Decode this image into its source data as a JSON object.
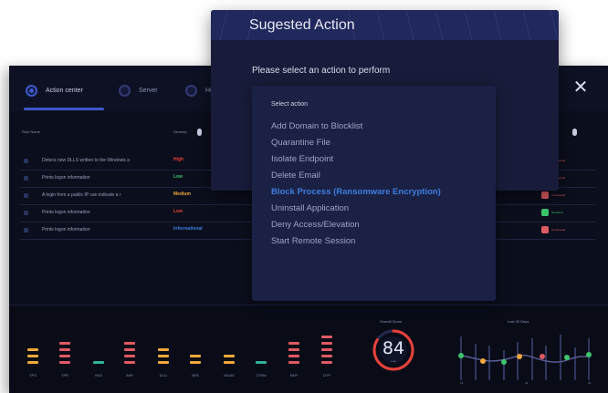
{
  "dashboard": {
    "tabs": [
      {
        "label": "Action center",
        "icon": "radio-icon",
        "active": true
      },
      {
        "label": "Server",
        "icon": "radio-icon",
        "active": false
      },
      {
        "label": "Hist",
        "icon": "radio-icon",
        "active": false
      }
    ],
    "close_glyph": "✕",
    "table": {
      "headers": {
        "name": "Rule Name",
        "severity": "Severity"
      },
      "rows": [
        {
          "name": "Detecs new DLLS written to the Windows a",
          "severity": "High",
          "severity_color": "#e8413a",
          "state": "Unresolved",
          "state_color": "#e05a63"
        },
        {
          "name": "Prints logon information",
          "severity": "Low",
          "severity_color": "#3cc46c",
          "state": "Unresolved",
          "state_color": "#e05a63"
        },
        {
          "name": "A login from a public IP can indicate a r",
          "severity": "Medium",
          "severity_color": "#f2a93b",
          "state": "Unresolved",
          "state_color": "#e05a63"
        },
        {
          "name": "Prints logon information",
          "severity": "Low",
          "severity_color": "#e8413a",
          "state": "Resolved",
          "state_color": "#3cc46c"
        },
        {
          "name": "Prints logon information",
          "severity": "Informational",
          "severity_color": "#3e7de0",
          "state": "Unresolved",
          "state_color": "#e05a63"
        }
      ]
    },
    "meters": [
      {
        "label": "TPS",
        "segments": 3,
        "color": "#f2a93b"
      },
      {
        "label": "TPR",
        "segments": 4,
        "color": "#e05a63"
      },
      {
        "label": "VND",
        "segments": 1,
        "color": "#2fb39a"
      },
      {
        "label": "SHP",
        "segments": 4,
        "color": "#e05a63"
      },
      {
        "label": "DCU",
        "segments": 3,
        "color": "#f2a93b"
      },
      {
        "label": "BFA",
        "segments": 2,
        "color": "#f2a93b"
      },
      {
        "label": "MUAV",
        "segments": 2,
        "color": "#f2a93b"
      },
      {
        "label": "ZTBM",
        "segments": 1,
        "color": "#2fb39a"
      },
      {
        "label": "BEP",
        "segments": 4,
        "color": "#e05a63"
      },
      {
        "label": "DTP",
        "segments": 5,
        "color": "#e05a63"
      }
    ],
    "overall_score": {
      "title": "Overall Score",
      "value": "84",
      "sub": "Low",
      "ring_color": "#e8413a"
    },
    "trend": {
      "title": "Last 30 Days",
      "x_labels": [
        "16",
        "24",
        "30"
      ]
    }
  },
  "modal": {
    "title": "Sugested Action",
    "prompt": "Please select an action to perform",
    "list_header": "Select action",
    "actions": [
      "Add Domain to Blocklist",
      "Quarantine File",
      "Isolate Endpoint",
      "Delete Email",
      "Block Process (Ransomware Encryption)",
      "Uninstall Application",
      "Deny Access/Elevation",
      "Start Remote Session"
    ],
    "selected_index": 4,
    "selected_color": "#3e7de0"
  }
}
